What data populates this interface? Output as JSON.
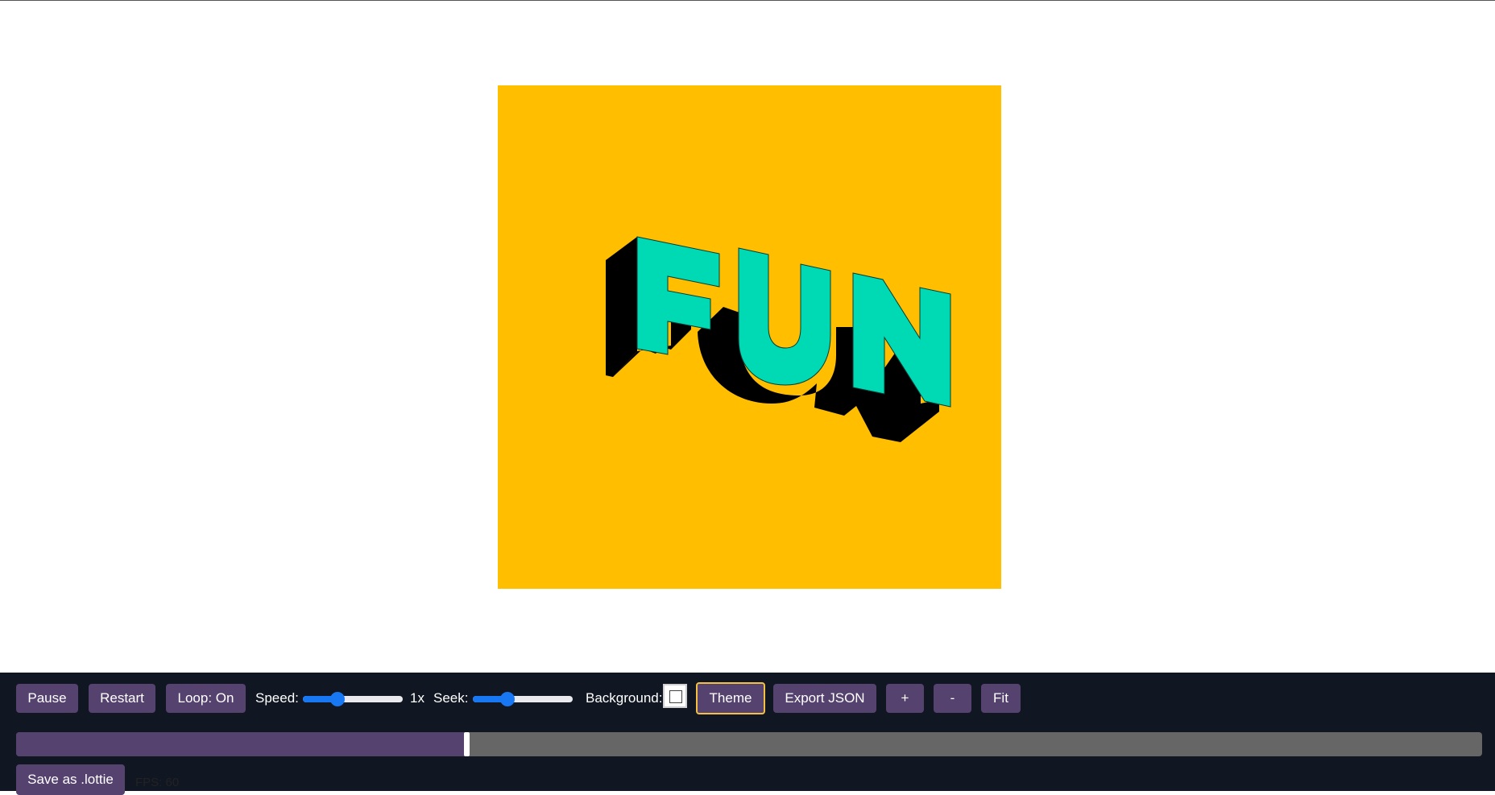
{
  "animation": {
    "text": "FUN",
    "background_color": "#FFBF00",
    "letter_color": "#00DAB4",
    "shadow_color": "#000000"
  },
  "controls": {
    "pause_label": "Pause",
    "restart_label": "Restart",
    "loop_label": "Loop: On",
    "speed_label": "Speed:",
    "speed_value": "1x",
    "speed_fraction": 0.35,
    "seek_label": "Seek:",
    "seek_fraction": 0.35,
    "background_label": "Background:",
    "background_value": "#ffffff",
    "theme_label": "Theme",
    "export_label": "Export JSON",
    "zoom_in_label": "+",
    "zoom_out_label": "-",
    "fit_label": "Fit",
    "timeline_progress": 0.307,
    "save_label": "Save as .lottie",
    "fps_text": "FPS: 60"
  },
  "colors": {
    "toolbar_bg": "#111722",
    "button_bg": "#55426f",
    "active_border": "#f4c042",
    "slider_accent": "#1877f2",
    "timeline_bg": "#666666"
  }
}
